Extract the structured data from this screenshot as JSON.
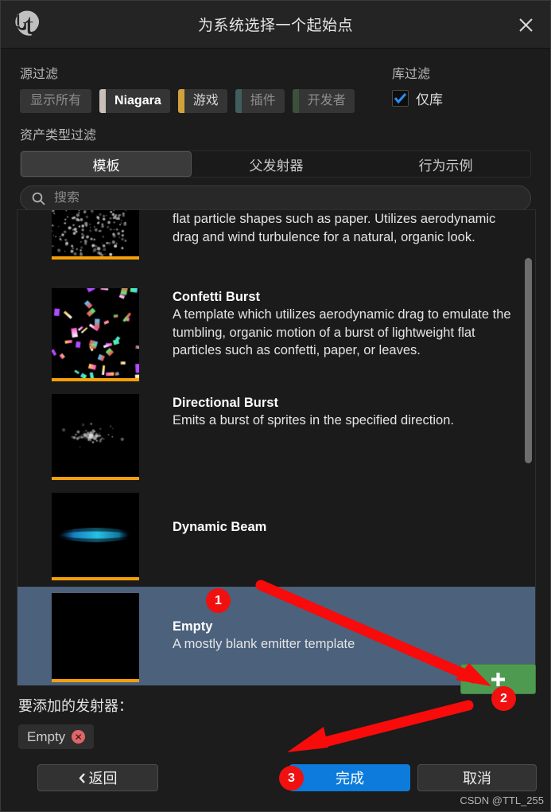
{
  "window": {
    "title": "为系统选择一个起始点",
    "logo_icon": "unreal-engine-logo",
    "close_icon": "close-icon"
  },
  "source_filter": {
    "label": "源过滤",
    "buttons": [
      {
        "label": "显示所有",
        "accent": "",
        "state": "dim"
      },
      {
        "label": "Niagara",
        "accent": "#c9bfb8",
        "state": "strong"
      },
      {
        "label": "游戏",
        "accent": "#d3a13a",
        "state": "normal"
      },
      {
        "label": "插件",
        "accent": "#3e5f5c",
        "state": "dim"
      },
      {
        "label": "开发者",
        "accent": "#3c513c",
        "state": "dim"
      }
    ]
  },
  "library_filter": {
    "label": "库过滤",
    "checkbox_label": "仅库",
    "checked": true,
    "check_icon": "checkmark-icon",
    "check_color": "#2b8ef0"
  },
  "asset_type_filter": {
    "label": "资产类型过滤",
    "tabs": [
      {
        "label": "模板",
        "active": true
      },
      {
        "label": "父发射器",
        "active": false
      },
      {
        "label": "行为示例",
        "active": false
      }
    ]
  },
  "search": {
    "icon": "search-icon",
    "value": "",
    "placeholder": "搜索"
  },
  "list": {
    "scrollbar_icon": "vertical-scrollbar",
    "items": [
      {
        "title": "",
        "desc": "flat particle shapes such as paper. Utilizes aerodynamic drag and wind turbulence for a natural, organic look.",
        "thumb": "sparse-white-particles",
        "partial_top": true,
        "selected": false
      },
      {
        "title": "Confetti Burst",
        "desc": "A template which utilizes aerodynamic drag to emulate the tumbling, organic motion of a burst of lightweight flat particles such as confetti, paper, or leaves.",
        "thumb": "rainbow-confetti",
        "selected": false
      },
      {
        "title": "Directional Burst",
        "desc": "Emits a burst of sprites in the specified direction.",
        "thumb": "white-sprite-burst",
        "selected": false
      },
      {
        "title": "Dynamic Beam",
        "desc": "",
        "thumb": "cyan-beam",
        "selected": false
      },
      {
        "title": "Empty",
        "desc": "A mostly blank emitter template",
        "thumb": "black-empty",
        "selected": true
      },
      {
        "title": "",
        "desc": "",
        "thumb": "sparse-white-particles",
        "partial_bottom": true,
        "selected": false
      }
    ]
  },
  "footer": {
    "add_label": "要添加的发射器：",
    "chip": {
      "label": "Empty",
      "remove_icon": "remove-circle-icon"
    },
    "add_button": {
      "label": "+",
      "icon": "plus-icon",
      "color": "#4e9a51"
    },
    "back_button": {
      "label": "返回",
      "icon": "chevron-left-icon"
    },
    "finish_button": {
      "label": "完成",
      "color": "#0c7bdc"
    },
    "cancel_button": {
      "label": "取消"
    },
    "watermark": "CSDN @TTL_255"
  },
  "annotations": {
    "badges": [
      {
        "number": "1"
      },
      {
        "number": "2"
      },
      {
        "number": "3"
      }
    ],
    "arrow_color": "#f80b0b"
  }
}
